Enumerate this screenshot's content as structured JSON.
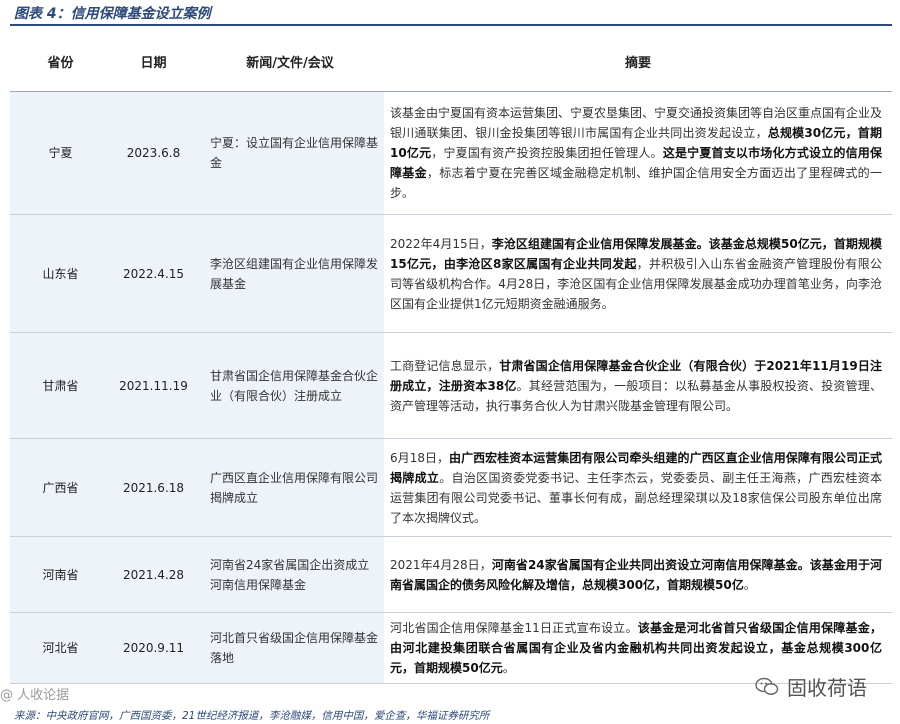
{
  "title": "图表 4：信用保障基金设立案例",
  "headers": {
    "province": "省份",
    "date": "日期",
    "news": "新闻/文件/会议",
    "summary": "摘要"
  },
  "rows": [
    {
      "province": "宁夏",
      "date": "2023.6.8",
      "news": "宁夏：设立国有企业信用保障基金",
      "summary": [
        {
          "t": "该基金由宁夏国有资本运营集团、宁夏农垦集团、宁夏交通投资集团等自治区重点国有企业及银川通联集团、银川金投集团等银川市属国有企业共同出资发起设立，"
        },
        {
          "t": "总规模30亿元，首期10亿元",
          "b": true
        },
        {
          "t": "，宁夏国有资产投资控股集团担任管理人。"
        },
        {
          "t": "这是宁夏首支以市场化方式设立的信用保障基金",
          "b": true
        },
        {
          "t": "，标志着宁夏在完善区域金融稳定机制、维护国企信用安全方面迈出了里程碑式的一步。"
        }
      ]
    },
    {
      "province": "山东省",
      "date": "2022.4.15",
      "news": "李沧区组建国有企业信用保障发展基金",
      "summary": [
        {
          "t": "2022年4月15日，"
        },
        {
          "t": "李沧区组建国有企业信用保障发展基金。该基金总规模50亿元，首期规模15亿元，由李沧区8家区属国有企业共同发起",
          "b": true
        },
        {
          "t": "，并积极引入山东省金融资产管理股份有限公司等省级机构合作。4月28日，李沧区国有企业信用保障发展基金成功办理首笔业务，向李沧区国有企业提供1亿元短期资金融通服务。"
        }
      ]
    },
    {
      "province": "甘肃省",
      "date": "2021.11.19",
      "news": "甘肃省国企信用保障基金合伙企业（有限合伙）注册成立",
      "summary": [
        {
          "t": "工商登记信息显示，"
        },
        {
          "t": "甘肃省国企信用保障基金合伙企业（有限合伙）于2021年11月19日注册成立，注册资本38亿",
          "b": true
        },
        {
          "t": "。其经营范围为，一般项目：以私募基金从事股权投资、投资管理、资产管理等活动，执行事务合伙人为甘肃兴陇基金管理有限公司。"
        }
      ]
    },
    {
      "province": "广西省",
      "date": "2021.6.18",
      "news": "广西区直企业信用保障有限公司揭牌成立",
      "summary": [
        {
          "t": "6月18日，"
        },
        {
          "t": "由广西宏桂资本运营集团有限公司牵头组建的广西区直企业信用保障有限公司正式揭牌成立",
          "b": true
        },
        {
          "t": "。自治区国资委党委书记、主任李杰云，党委委员、副主任王海燕，广西宏桂资本运营集团有限公司党委书记、董事长何有成，副总经理梁琪以及18家信保公司股东单位出席了本次揭牌仪式。"
        }
      ]
    },
    {
      "province": "河南省",
      "date": "2021.4.28",
      "news": "河南省24家省属国企出资成立河南信用保障基金",
      "summary": [
        {
          "t": "2021年4月28日，"
        },
        {
          "t": "河南省24家省属国有企业共同出资设立河南信用保障基金。该基金用于河南省属国企的债务风险化解及增信，总规模300亿，首期规模50亿",
          "b": true
        },
        {
          "t": "。"
        }
      ]
    },
    {
      "province": "河北省",
      "date": "2020.9.11",
      "news": "河北首只省级国企信用保障基金落地",
      "summary": [
        {
          "t": "河北省国企信用保障基金11日正式宣布设立。"
        },
        {
          "t": "该基金是河北省首只省级国企信用保障基金，由河北建投集团联合省属国有企业及省内金融机构共同出资发起设立，基金总规模300亿元，首期规模50亿元",
          "b": true
        },
        {
          "t": "。"
        }
      ]
    }
  ],
  "source": "来源：中央政府官网，广西国资委，21世纪经济报道，李沧融媒，信用中国，爱企查，华福证券研究所",
  "watermark_left": "@ 人收论据",
  "watermark_right": "固收荷语"
}
